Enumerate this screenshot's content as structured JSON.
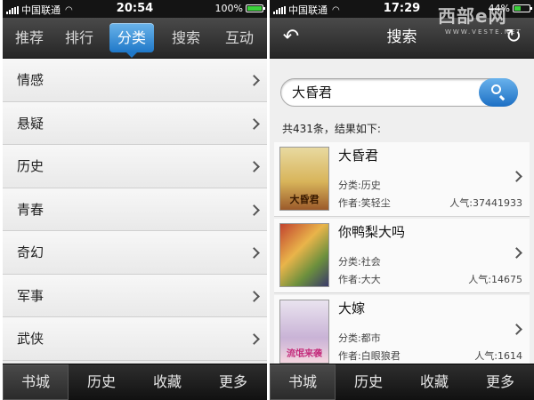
{
  "left": {
    "status": {
      "carrier": "中国联通",
      "time": "20:54",
      "battery": "100%",
      "battery_level": 1.0
    },
    "topnav": {
      "tabs": [
        {
          "label": "推荐",
          "active": false
        },
        {
          "label": "排行",
          "active": false
        },
        {
          "label": "分类",
          "active": true
        },
        {
          "label": "搜索",
          "active": false
        },
        {
          "label": "互动",
          "active": false
        }
      ]
    },
    "categories": [
      "情感",
      "悬疑",
      "历史",
      "青春",
      "奇幻",
      "军事",
      "武侠"
    ],
    "tabbar": [
      {
        "label": "书城",
        "active": true
      },
      {
        "label": "历史",
        "active": false
      },
      {
        "label": "收藏",
        "active": false
      },
      {
        "label": "更多",
        "active": false
      }
    ]
  },
  "right": {
    "status": {
      "carrier": "中国联通",
      "time": "17:29",
      "battery": "44%",
      "battery_level": 0.44
    },
    "header": {
      "title": "搜索",
      "back_icon": "back-arrow-icon",
      "refresh_icon": "refresh-icon"
    },
    "search": {
      "value": "大昏君"
    },
    "result_count": "共431条，结果如下:",
    "results": [
      {
        "title": "大昏君",
        "category": "分类:历史",
        "author": "作者:笑轻尘",
        "popularity": "人气:37441933",
        "cover_text": "大昏君"
      },
      {
        "title": "你鸭梨大吗",
        "category": "分类:社会",
        "author": "作者:大大",
        "popularity": "人气:14675",
        "cover_text": ""
      },
      {
        "title": "大嫁",
        "category": "分类:都市",
        "author": "作者:白眼狼君",
        "popularity": "人气:1614",
        "cover_text": "流氓来袭"
      }
    ],
    "tabbar": [
      {
        "label": "书城",
        "active": true
      },
      {
        "label": "历史",
        "active": false
      },
      {
        "label": "收藏",
        "active": false
      },
      {
        "label": "更多",
        "active": false
      }
    ]
  },
  "watermark": {
    "cn": "西部e网",
    "en": "WWW.VESTE.NET"
  },
  "colors": {
    "accent": "#1f78c9",
    "dark_bar": "#2b2b2b",
    "battery_green": "#3bd13b"
  }
}
